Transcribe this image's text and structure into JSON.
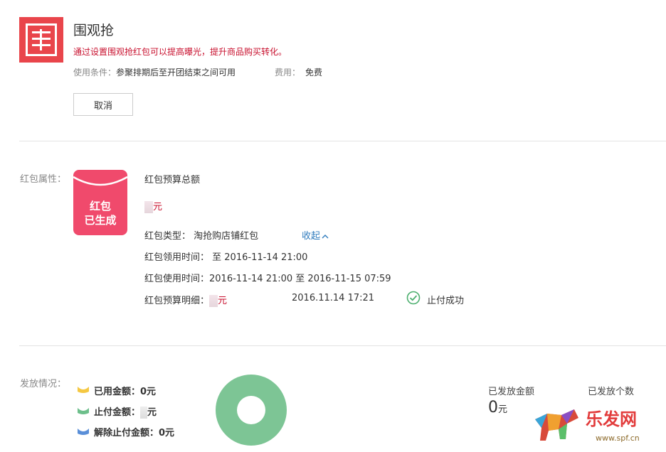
{
  "header": {
    "title": "围观抢",
    "subtitle": "通过设置围观抢红包可以提高曝光，提升商品购买转化。",
    "condition_label": "使用条件：",
    "condition_value": "参聚排期后至开团结束之间可用",
    "fee_label": "费用：",
    "fee_value": "免费",
    "cancel_label": "取消",
    "logo_icon": "wei-logo-icon"
  },
  "attributes": {
    "section_label": "红包属性：",
    "packet_line1": "红包",
    "packet_line2": "已生成",
    "budget_total_label": "红包预算总额",
    "budget_unit": "元",
    "type_label": "红包类型：",
    "type_value": "淘抢购店铺红包",
    "collapse_label": "收起",
    "collapse_icon": "chevron-up-icon",
    "claim_time_label": "红包领用时间：",
    "claim_time_value": "至 2016-11-14 21:00",
    "use_time_label": "红包使用时间：",
    "use_time_value": "2016-11-14 21:00 至 2016-11-15 07:59",
    "detail_label": "红包预算明细：",
    "detail_unit": "元",
    "detail_time": "2016.11.14 17:21",
    "detail_status": "止付成功"
  },
  "distribution": {
    "section_label": "发放情况：",
    "legend": [
      {
        "label": "已用金额：0元",
        "color": "#f5c842",
        "icon": "yellow-packet-icon"
      },
      {
        "label": "止付金额：",
        "unit": "元",
        "color": "#6dbf8b",
        "icon": "green-packet-icon"
      },
      {
        "label": "解除止付金额：0元",
        "color": "#5a8fd8",
        "icon": "blue-packet-icon"
      }
    ],
    "donut_color": "#7dc595",
    "issued_amount_label": "已发放金额",
    "issued_amount_value": "0",
    "issued_amount_unit": "元",
    "issued_count_label": "已发放个数"
  },
  "watermark": {
    "brand": "乐发网",
    "url": "www.spf.cn"
  }
}
